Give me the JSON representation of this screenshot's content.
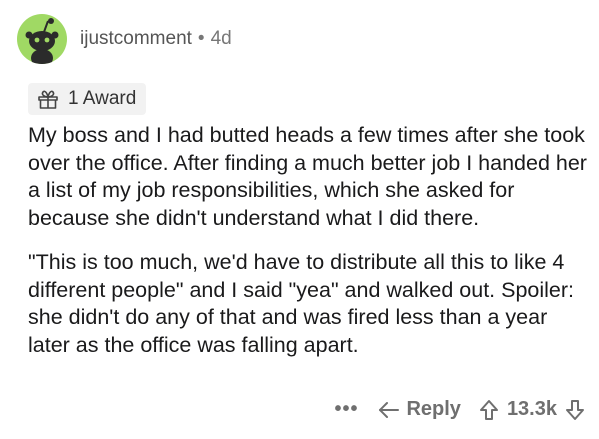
{
  "comment": {
    "author": "ijustcomment",
    "separator": "•",
    "age": "4d",
    "award_label": "1 Award",
    "paragraphs": [
      "My boss and I had butted heads a few times after she took over the office.  After finding a much better job I handed her a list of my job responsibilities, which she asked for because she didn't understand what I did there.",
      "\"This is too much, we'd have to distribute all this to like 4 different people\" and I said \"yea\" and walked out.  Spoiler: she didn't do any of that and was fired less than a year later as the office was falling apart."
    ]
  },
  "actions": {
    "more_label": "•••",
    "reply_label": "Reply",
    "score": "13.3k"
  },
  "icons": {
    "avatar": "snoo-avatar-icon",
    "award": "award-icon",
    "reply": "reply-arrow-icon",
    "upvote": "upvote-arrow-icon",
    "downvote": "downvote-arrow-icon"
  },
  "colors": {
    "avatar_bg": "#a0d964",
    "meta_text": "#777777",
    "action_text": "#6f6f6f"
  }
}
